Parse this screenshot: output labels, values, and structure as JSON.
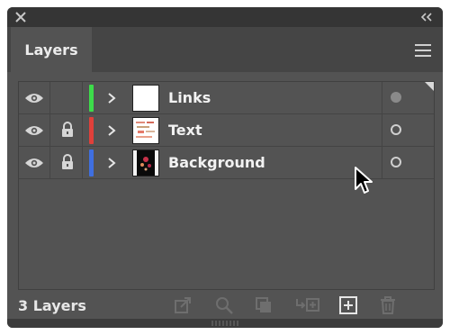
{
  "panel": {
    "tab_title": "Layers",
    "footer_count": "3 Layers"
  },
  "icons": {
    "close": "close-icon",
    "collapse": "double-chevron-left-icon",
    "menu": "hamburger-menu-icon",
    "visibility": "eye-icon",
    "lock": "lock-icon",
    "expand": "chevron-right-icon",
    "footer": [
      "export-icon",
      "search-icon",
      "clip-icon",
      "move-to-layer-icon",
      "add-layer-icon",
      "trash-icon"
    ]
  },
  "layers": [
    {
      "name": "Links",
      "color": "#3ddc4a",
      "locked": false,
      "visible": true,
      "target_filled": true
    },
    {
      "name": "Text",
      "color": "#e0403a",
      "locked": true,
      "visible": true,
      "target_filled": false
    },
    {
      "name": "Background",
      "color": "#3f6fe0",
      "locked": true,
      "visible": true,
      "target_filled": false
    }
  ],
  "colors": {
    "panel_bg": "#535353",
    "title_bg": "#353535",
    "text": "#f2f2f2"
  }
}
